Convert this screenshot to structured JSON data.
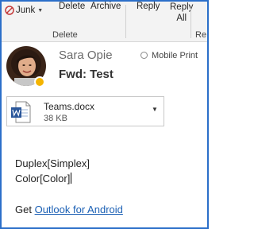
{
  "ribbon": {
    "junk_label": "Junk",
    "delete_label": "Delete",
    "archive_label": "Archive",
    "reply_label": "Reply",
    "reply_all_line1": "Reply",
    "reply_all_line2": "All",
    "group_delete": "Delete",
    "group_respond": "Re"
  },
  "message": {
    "sender": "Sara Opie",
    "subject": "Fwd: Test",
    "mobile_print_label": "Mobile Print"
  },
  "attachment": {
    "name": "Teams.docx",
    "size": "38 KB"
  },
  "body": {
    "line1": "Duplex[Simplex]",
    "line2": "Color[Color]",
    "footer_prefix": "Get ",
    "footer_link": "Outlook for Android"
  },
  "colors": {
    "frame": "#2b6fc9",
    "presence": "#f4b400",
    "link": "#1a5fb4",
    "word_icon": "#2b579a"
  }
}
